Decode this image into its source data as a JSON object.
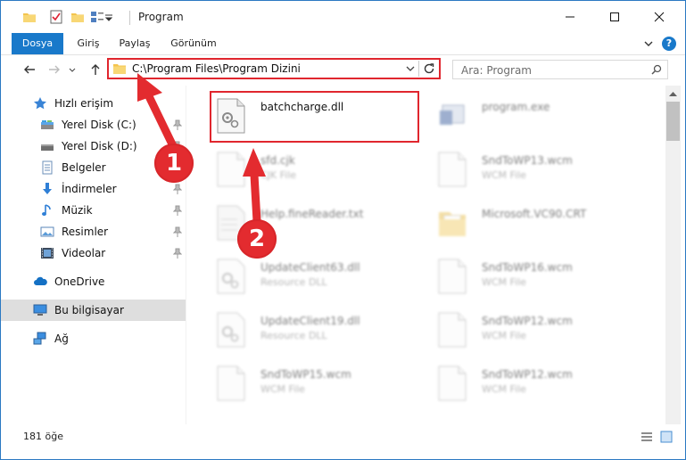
{
  "window": {
    "title": "Program",
    "minimize_label": "Simge durumuna küçült",
    "maximize_label": "Ekranı kapla",
    "close_label": "Kapat"
  },
  "ribbon": {
    "tabs": [
      "Dosya",
      "Giriş",
      "Paylaş",
      "Görünüm"
    ],
    "help": "?"
  },
  "address": {
    "path": "C:\\Program Files\\Program Dizini"
  },
  "search": {
    "placeholder": "Ara: Program"
  },
  "sidebar": {
    "items": [
      {
        "label": "Hızlı erişim",
        "icon": "star-icon"
      },
      {
        "label": "Yerel Disk (C:)",
        "icon": "disk-icon",
        "pinned": true
      },
      {
        "label": "Yerel Disk (D:)",
        "icon": "disk-icon",
        "pinned": true
      },
      {
        "label": "Belgeler",
        "icon": "documents-icon",
        "pinned": true
      },
      {
        "label": "İndirmeler",
        "icon": "download-icon",
        "pinned": true
      },
      {
        "label": "Müzik",
        "icon": "music-icon",
        "pinned": true
      },
      {
        "label": "Resimler",
        "icon": "pictures-icon",
        "pinned": true
      },
      {
        "label": "Videolar",
        "icon": "videos-icon",
        "pinned": true
      },
      {
        "label": "OneDrive",
        "icon": "cloud-icon"
      },
      {
        "label": "Bu bilgisayar",
        "icon": "computer-icon",
        "selected": true
      },
      {
        "label": "Ağ",
        "icon": "network-icon"
      }
    ]
  },
  "files": [
    {
      "name": "batchcharge.dll",
      "type": "",
      "icon": "dll-file-icon",
      "highlighted": true
    },
    {
      "name": "program.exe",
      "type": "",
      "icon": "exe-file-icon"
    },
    {
      "name": "sfd.cjk",
      "type": "CJK File",
      "icon": "file-icon"
    },
    {
      "name": "SndToWP13.wcm",
      "type": "WCM File",
      "icon": "file-icon"
    },
    {
      "name": "Help.fineReader.txt",
      "type": "",
      "icon": "file-icon"
    },
    {
      "name": "Microsoft.VC90.CRT",
      "type": "",
      "icon": "folder-icon"
    },
    {
      "name": "UpdateClient63.dll",
      "type": "Resource DLL",
      "icon": "dll-file-icon"
    },
    {
      "name": "SndToWP16.wcm",
      "type": "WCM File",
      "icon": "file-icon"
    },
    {
      "name": "UpdateClient19.dll",
      "type": "Resource DLL",
      "icon": "dll-file-icon"
    },
    {
      "name": "SndToWP12.wcm",
      "type": "WCM File",
      "icon": "file-icon"
    },
    {
      "name": "SndToWP15.wcm",
      "type": "WCM File",
      "icon": "file-icon"
    },
    {
      "name": "SndToWP12.wcm",
      "type": "WCM File",
      "icon": "file-icon"
    }
  ],
  "status": {
    "count": "181 öğe"
  },
  "annotations": {
    "step1": "1",
    "step2": "2",
    "color": "#e32b2f"
  }
}
